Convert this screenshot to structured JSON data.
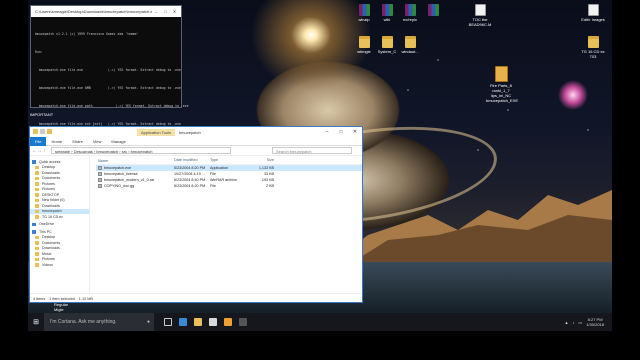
{
  "console": {
    "title": "C:\\Users\\smeagle\\Desktop\\Downloads\\bmuxepatch\\bmuxepatch.exe",
    "lines": [
      "bmuxepatch v1.2.1 (c) 1999 Francisco Gomez aka 'temme'",
      "Run:",
      "  bmuxepatch.exe file.exe             (->) YES format. Extract debug to .exe",
      "  bmuxepatch.exe file.exe 8MB         (->) YES format. Extract debug to .exe",
      "  bmuxepatch.exe file.exe path            (->) YES format. Extract debug to .exe",
      "  bmuxepatch.exe file.exe ext [ext]   (->) YES format. Extract debug to .exe",
      "",
      "Press any key to continue . . ."
    ],
    "controls": [
      "–",
      "□",
      "✕"
    ]
  },
  "desktop_icons": [
    {
      "label": "winzip",
      "icon": "rar-icon"
    },
    {
      "label": "wiki",
      "icon": "rar-icon"
    },
    {
      "label": "ex/repic",
      "icon": "rar-icon"
    },
    {
      "label": "TOC the BEAD96C.M",
      "icon": "document-icon"
    },
    {
      "label": "Edit/r Images",
      "icon": "document-icon"
    },
    {
      "label": "wlnngle",
      "icon": "folder-icon"
    },
    {
      "label": "System_C",
      "icon": "folder-icon"
    },
    {
      "label": "windaut...",
      "icon": "folder-icon"
    },
    {
      "label": "TG 16 CD ex 703",
      "icon": "folder-icon"
    },
    {
      "label": "Fire Parts_8 rankl_1_7 lips_ini_NC bmuxepatch_EXE",
      "icon": "zip-icon"
    }
  ],
  "desktop_labels": {
    "important": "IMPORTANT",
    "bottom_left": "Regular\nMigle"
  },
  "explorer": {
    "context_tab": "Application Tools",
    "window_name": "bmuxepatch",
    "ribbon_tabs": [
      "File",
      "Home",
      "Share",
      "View",
      "Manage"
    ],
    "path": [
      "smeagle",
      "Descargas",
      "bmuxepatch",
      "src",
      "bmuxepatch"
    ],
    "search_placeholder": "Search bmuxepatch",
    "nav_items": [
      {
        "label": "Quick access",
        "section": true
      },
      {
        "label": "Desktop"
      },
      {
        "label": "Downloads"
      },
      {
        "label": "Documents"
      },
      {
        "label": "Pictures"
      },
      {
        "label": "Pictures"
      },
      {
        "label": "DESKTOP"
      },
      {
        "label": "New folder (6)"
      },
      {
        "label": "Downloads"
      },
      {
        "label": "bmuxepatch"
      },
      {
        "label": "TG 16 CD ex"
      },
      {
        "label": "OneDrive",
        "section": true
      },
      {
        "label": "This PC",
        "section": true
      },
      {
        "label": "Desktop"
      },
      {
        "label": "Documents"
      },
      {
        "label": "Downloads"
      },
      {
        "label": "Music"
      },
      {
        "label": "Pictures"
      },
      {
        "label": "Videos"
      }
    ],
    "columns": [
      "Name",
      "Date modified",
      "Type",
      "Size"
    ],
    "files": [
      {
        "name": "bmuxepatch.exe",
        "date": "5/23/2004 8:20 PM",
        "type": "Application",
        "size": "1,133 KB",
        "selected": true
      },
      {
        "name": "bmuxepatch_license",
        "date": "10/27/2008 4:19 ...",
        "type": "File",
        "size": "33 KB"
      },
      {
        "name": "bmuxepatch_modern_v1_0.rar",
        "date": "6/23/2004 8:40 PM",
        "type": "WinRAR archive",
        "size": "193 KB"
      },
      {
        "name": "COPYING_doc.gg",
        "date": "8/23/2004 8:20 PM",
        "type": "File",
        "size": "2 KB"
      }
    ],
    "status": {
      "items": "4 items",
      "selected": "1 item selected",
      "size": "1.10 MB"
    }
  },
  "taskbar": {
    "search_placeholder": "I'm Cortana. Ask me anything.",
    "time": "8:27 PM",
    "date": "1/30/2018"
  }
}
